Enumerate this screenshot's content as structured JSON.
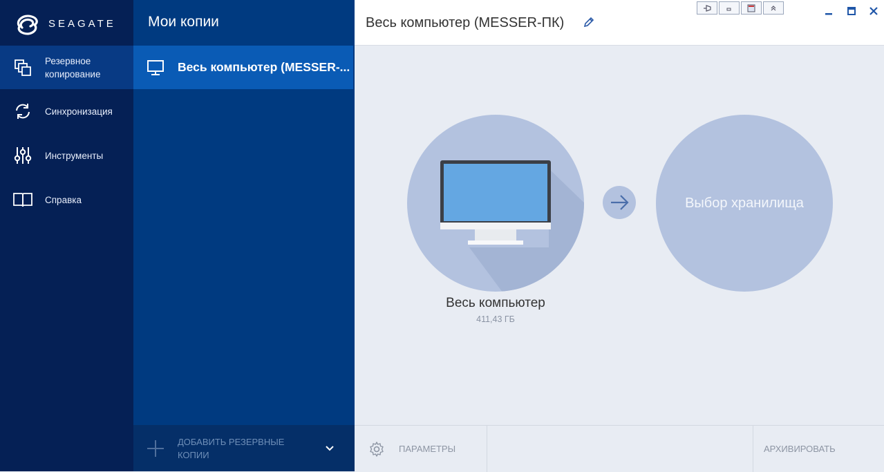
{
  "brand": {
    "name": "SEAGATE"
  },
  "nav": {
    "items": [
      {
        "label": "Резервное копирование",
        "icon": "backup-icon",
        "active": true
      },
      {
        "label": "Синхронизация",
        "icon": "sync-icon",
        "active": false
      },
      {
        "label": "Инструменты",
        "icon": "tools-icon",
        "active": false
      },
      {
        "label": "Справка",
        "icon": "book-icon",
        "active": false
      }
    ]
  },
  "backups": {
    "title": "Мои копии",
    "items": [
      {
        "label": "Весь компьютер (MESSER-...",
        "icon": "monitor-icon",
        "selected": true
      }
    ],
    "add_label": "ДОБАВИТЬ РЕЗЕРВНЫЕ КОПИИ"
  },
  "main": {
    "title": "Весь компьютер (MESSER-ПК)",
    "source": {
      "label": "Весь компьютер",
      "size": "411,43 ГБ"
    },
    "destination": {
      "label": "Выбор хранилища"
    },
    "params_label": "ПАРАМЕТРЫ",
    "archive_label": "АРХИВИРОВАТЬ"
  },
  "colors": {
    "nav_bg": "#052055",
    "list_bg": "#003a80",
    "selected_bg": "#0a5bb5",
    "circle": "#b3c2df",
    "content_bg": "#e8ecf3"
  }
}
